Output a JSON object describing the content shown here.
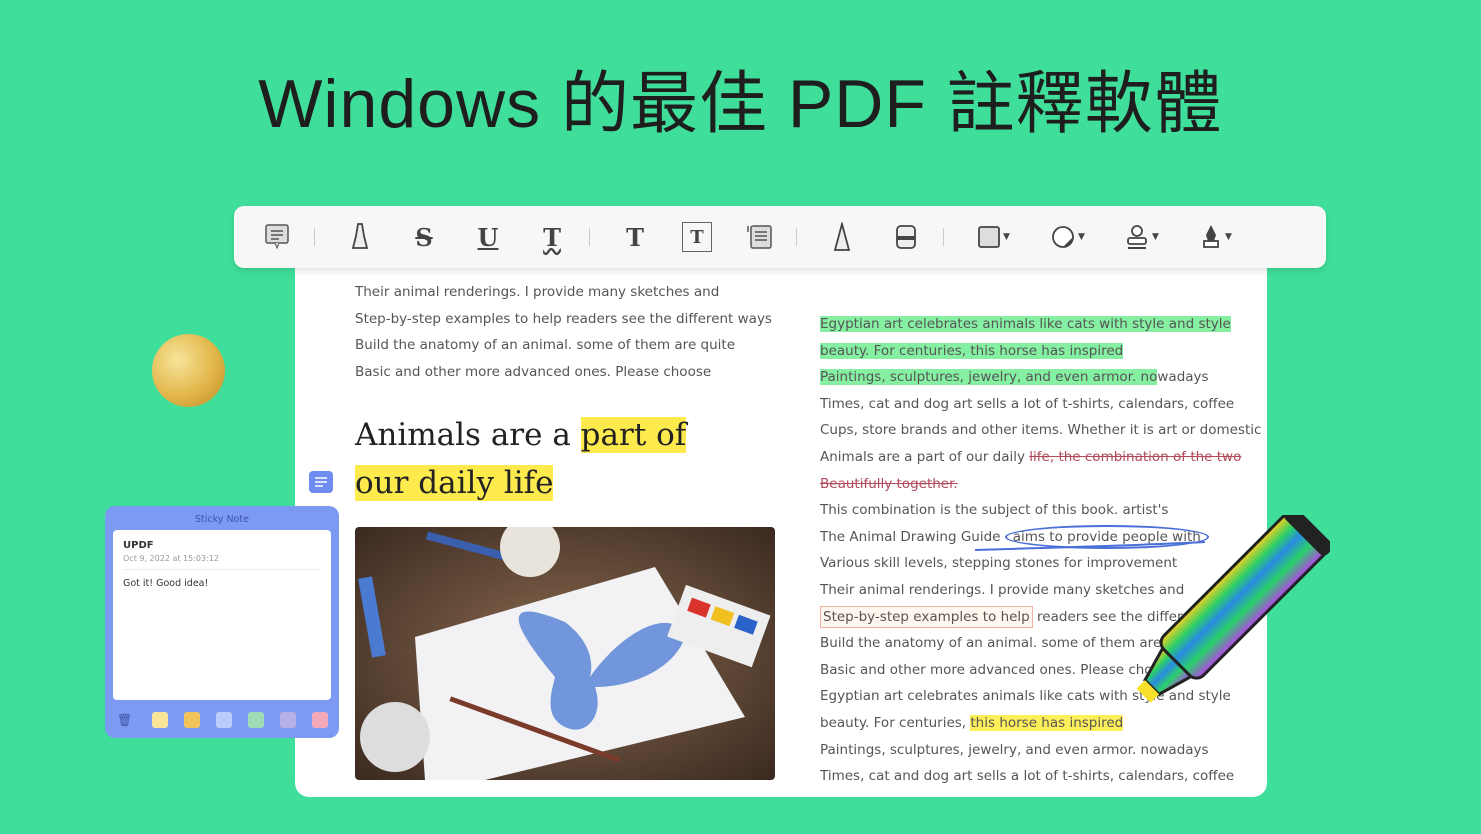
{
  "title": "Windows 的最佳 PDF 註釋軟體",
  "toolbar": {
    "items": [
      "comment-icon",
      "highlight-icon",
      "strikethrough-icon",
      "underline-icon",
      "squiggly-icon",
      "text-icon",
      "text-box-icon",
      "text-callout-icon",
      "pencil-icon",
      "eraser-icon",
      "shape-icon",
      "sticker-icon",
      "stamp-icon",
      "signature-icon"
    ]
  },
  "left": {
    "lines": [
      "Their animal renderings. I provide many sketches and",
      "Step-by-step examples to help readers see the different ways",
      "Build the anatomy of an animal. some of them are quite",
      "Basic and other more advanced ones. Please choose"
    ],
    "heading": {
      "a": "Animals are a ",
      "b": "part of",
      "c": "our daily life"
    }
  },
  "right": {
    "lines": [
      [
        {
          "t": "Egyptian art celebrates animals like cats with style and style",
          "c": "g"
        }
      ],
      [
        {
          "t": "beauty. For centuries, this horse has inspired",
          "c": "g"
        }
      ],
      [
        {
          "t": "Paintings, sculptures, jewelry, and even armor. no",
          "c": "g"
        },
        {
          "t": "wadays",
          "c": ""
        }
      ],
      [
        {
          "t": "Times, cat and dog art sells a lot of t-shirts, calendars, coffee",
          "c": ""
        }
      ],
      [
        {
          "t": "Cups, store brands and other items. Whether it is art or domestic",
          "c": ""
        }
      ],
      [
        {
          "t": "Animals are a part of our daily ",
          "c": ""
        },
        {
          "t": "life, the combination of the two",
          "c": "s"
        }
      ],
      [
        {
          "t": "Beautifully together.",
          "c": "s"
        }
      ],
      [
        {
          "t": "This combination is the subject of this book. artist's",
          "c": ""
        }
      ],
      [
        {
          "t": "The Animal Drawing Guide ",
          "c": ""
        },
        {
          "t": "aims to provide people with",
          "c": "o"
        }
      ],
      [
        {
          "t": "Various skill levels, stepping stones for improvement",
          "c": ""
        }
      ],
      [
        {
          "t": "Their animal renderings. I provide many sketches and",
          "c": ""
        }
      ],
      [
        {
          "t": "Step-by-step examples to help",
          "c": "b"
        },
        {
          "t": " readers see the different ways",
          "c": ""
        }
      ],
      [
        {
          "t": "Build the anatomy of an animal. some of them are quite",
          "c": ""
        }
      ],
      [
        {
          "t": "Basic and other more advanced ones. Please choose",
          "c": ""
        }
      ],
      [
        {
          "t": "Egyptian art celebrates animals like cats with style and style",
          "c": ""
        }
      ],
      [
        {
          "t": "beauty. For centuries, ",
          "c": ""
        },
        {
          "t": "this horse has inspired",
          "c": "y"
        }
      ],
      [
        {
          "t": "Paintings, sculptures, jewelry, and even armor. nowadays",
          "c": ""
        }
      ],
      [
        {
          "t": "Times, cat and dog art sells a lot of t-shirts, calendars, coffee",
          "c": ""
        }
      ]
    ]
  },
  "sticky": {
    "title": "Sticky Note",
    "author": "UPDF",
    "date": "Oct 9, 2022 at 15:03:12",
    "message": "Got it!  Good idea!",
    "colors": [
      "#fbe29a",
      "#f2c45e",
      "#b9cdfb",
      "#9edcb7",
      "#b7b0e6",
      "#f3a9b7"
    ]
  },
  "colors": {
    "background": "#3fdf9b",
    "highlight_green": "#86f0a2",
    "highlight_yellow": "#fdea4d",
    "sticky": "#7d9af2"
  }
}
